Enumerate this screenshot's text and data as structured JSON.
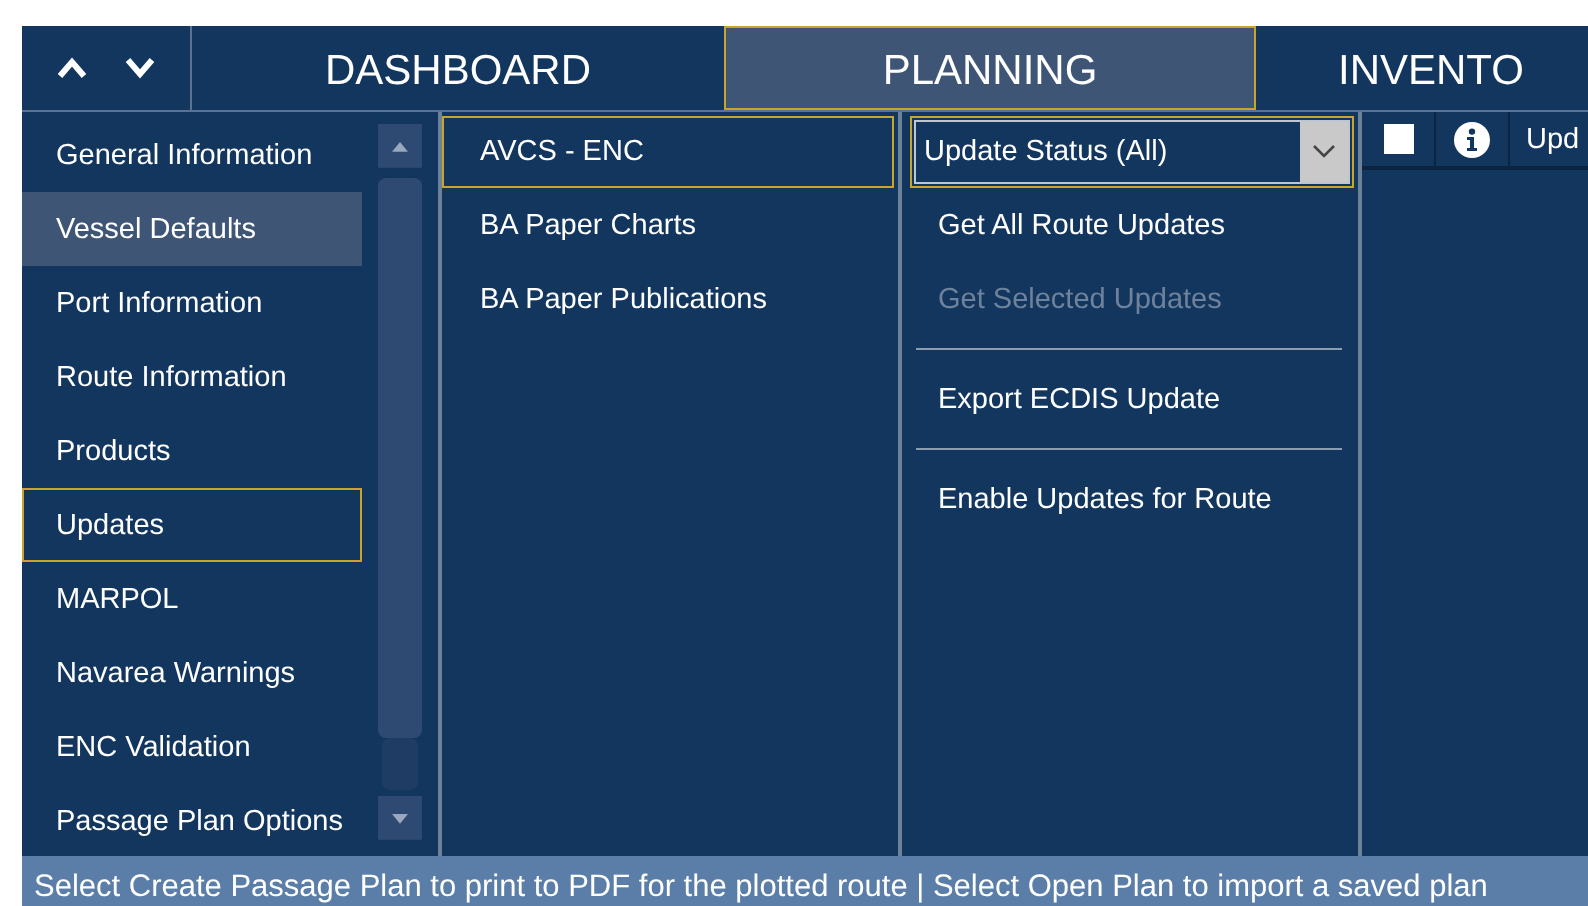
{
  "tabs": [
    {
      "label": "DASHBOARD",
      "selected": false
    },
    {
      "label": "PLANNING",
      "selected": true
    },
    {
      "label": "INVENTO",
      "selected": false
    }
  ],
  "sidebar": {
    "items": [
      {
        "label": "General Information",
        "selected": false,
        "highlighted": false
      },
      {
        "label": "Vessel Defaults",
        "selected": false,
        "highlighted": true
      },
      {
        "label": "Port Information",
        "selected": false,
        "highlighted": false
      },
      {
        "label": "Route Information",
        "selected": false,
        "highlighted": false
      },
      {
        "label": "Products",
        "selected": false,
        "highlighted": false
      },
      {
        "label": "Updates",
        "selected": true,
        "highlighted": false
      },
      {
        "label": "MARPOL",
        "selected": false,
        "highlighted": false
      },
      {
        "label": "Navarea Warnings",
        "selected": false,
        "highlighted": false
      },
      {
        "label": "ENC Validation",
        "selected": false,
        "highlighted": false
      },
      {
        "label": "Passage Plan Options",
        "selected": false,
        "highlighted": false
      }
    ]
  },
  "products": [
    {
      "label": "AVCS - ENC",
      "selected": true
    },
    {
      "label": "BA Paper Charts",
      "selected": false
    },
    {
      "label": "BA Paper Publications",
      "selected": false
    }
  ],
  "status_filter": {
    "value": "Update Status (All)"
  },
  "actions": [
    {
      "label": "Get All Route Updates",
      "disabled": false,
      "separator_after": false
    },
    {
      "label": "Get Selected Updates",
      "disabled": true,
      "separator_after": true
    },
    {
      "label": "Export ECDIS Update",
      "disabled": false,
      "separator_after": true
    },
    {
      "label": "Enable Updates for Route",
      "disabled": false,
      "separator_after": false
    }
  ],
  "table": {
    "select_all_checked": false,
    "columns": [
      "Upd"
    ]
  },
  "status_bar": "Select Create Passage Plan to print to PDF for the plotted route | Select Open Plan to import a saved plan"
}
